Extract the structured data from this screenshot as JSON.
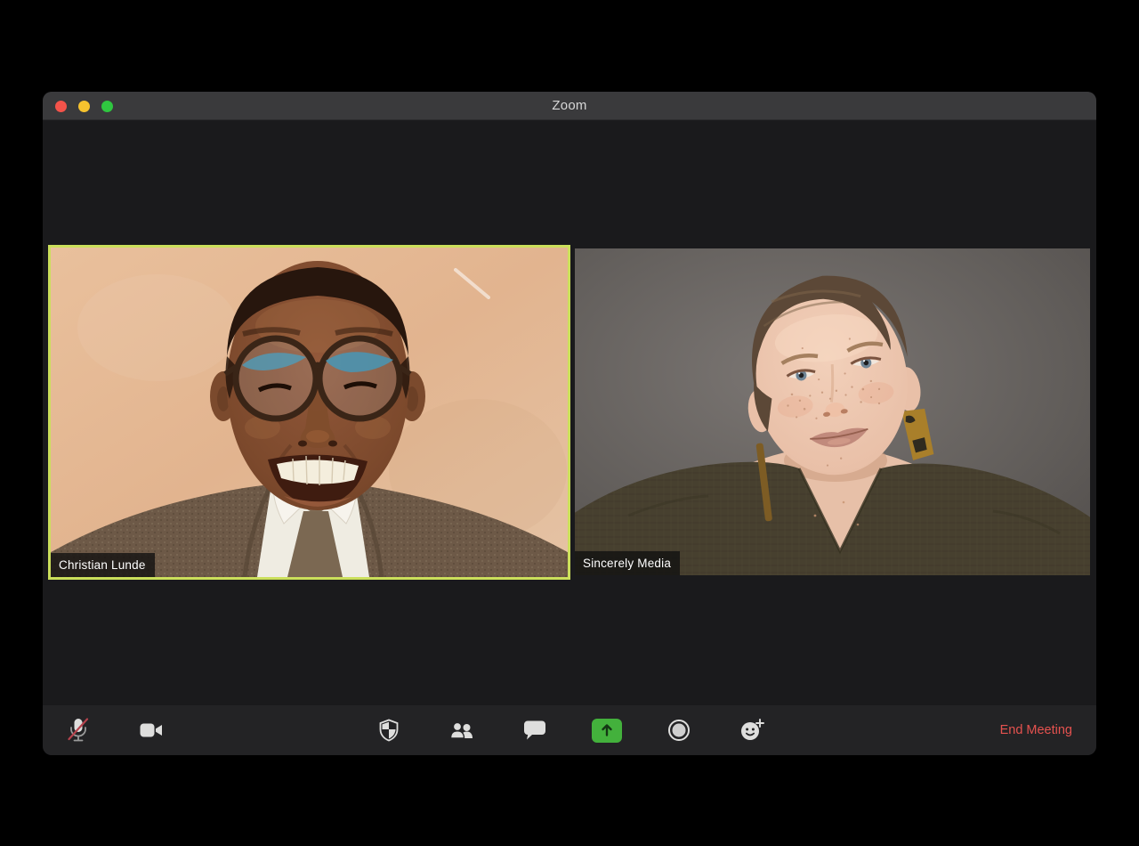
{
  "window": {
    "title": "Zoom"
  },
  "traffic_lights": {
    "close_color": "#f4534a",
    "minimize_color": "#f6c22e",
    "zoom_color": "#2fc640"
  },
  "participants": [
    {
      "name": "Christian Lunde",
      "active_speaker": true
    },
    {
      "name": "Sincerely Media",
      "active_speaker": false
    }
  ],
  "toolbar": {
    "buttons": [
      {
        "id": "mute",
        "icon": "microphone-muted-icon",
        "state": "muted"
      },
      {
        "id": "video",
        "icon": "video-camera-icon",
        "state": "on"
      },
      {
        "id": "security",
        "icon": "security-shield-icon"
      },
      {
        "id": "participants",
        "icon": "participants-icon"
      },
      {
        "id": "chat",
        "icon": "chat-bubble-icon"
      },
      {
        "id": "share-screen",
        "icon": "share-screen-up-arrow-icon",
        "accent": "#43b13c"
      },
      {
        "id": "record",
        "icon": "record-circle-icon"
      },
      {
        "id": "reactions",
        "icon": "reactions-smiley-plus-icon"
      }
    ],
    "end_meeting_label": "End Meeting",
    "end_meeting_color": "#e5524f"
  },
  "colors": {
    "desktop_background": "#000000",
    "titlebar_bg": "#3a3a3c",
    "window_bg": "#1a1a1c",
    "toolbar_bg": "#232325",
    "active_speaker_border": "#cbdf5b",
    "name_label_bg": "rgba(15,15,15,0.78)",
    "mute_slash_red": "#b5434d",
    "icon_color": "#d9d9d9"
  }
}
